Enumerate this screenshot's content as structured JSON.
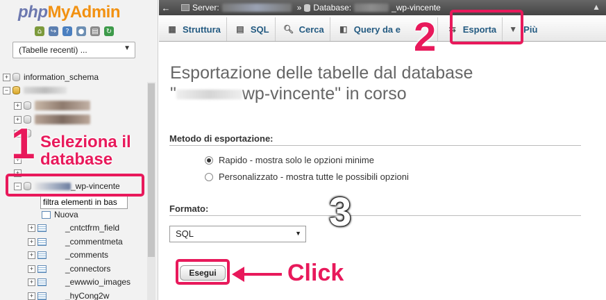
{
  "logo": {
    "php": "php",
    "my": "My",
    "admin": "Admin"
  },
  "recent_tables": {
    "value": "(Tabelle recenti) ..."
  },
  "tree": {
    "info_schema": "information_schema",
    "selected_db_suffix": "_wp-vincente",
    "filter_placeholder": "filtra elementi in bas",
    "new_item": "Nuova",
    "tables": [
      "_cntctfrm_field",
      "_commentmeta",
      "_comments",
      "_connectors",
      "_ewwwio_images",
      "_hyCong2w"
    ]
  },
  "breadcrumb": {
    "back": "←",
    "server_label": "Server:",
    "separator": "»",
    "database_label": "Database:",
    "database_suffix": "_wp-vincente"
  },
  "tabs": [
    {
      "label": "Struttura"
    },
    {
      "label": "SQL"
    },
    {
      "label": "Cerca"
    },
    {
      "label": "Query da e"
    },
    {
      "label": "Esporta"
    },
    {
      "label": "Più"
    }
  ],
  "main": {
    "heading_line1": "Esportazione delle tabelle dal database",
    "heading_line2_prefix": "\"",
    "heading_line2_suffix": "wp-vincente\" in corso",
    "method_label": "Metodo di esportazione:",
    "method_quick": "Rapido - mostra solo le opzioni minime",
    "method_custom": "Personalizzato - mostra tutte le possibili opzioni",
    "format_label": "Formato:",
    "format_value": "SQL",
    "go_button": "Esegui"
  },
  "annotations": {
    "step1_number": "1",
    "step1_text_line1": "Seleziona il",
    "step1_text_line2": "database",
    "step2_number": "2",
    "step3_number": "3",
    "click_text": "Click"
  },
  "colors": {
    "annotation": "#e8195b",
    "tab_text": "#235a81",
    "logo_orange": "#f29111",
    "logo_blue": "#6c78af"
  }
}
